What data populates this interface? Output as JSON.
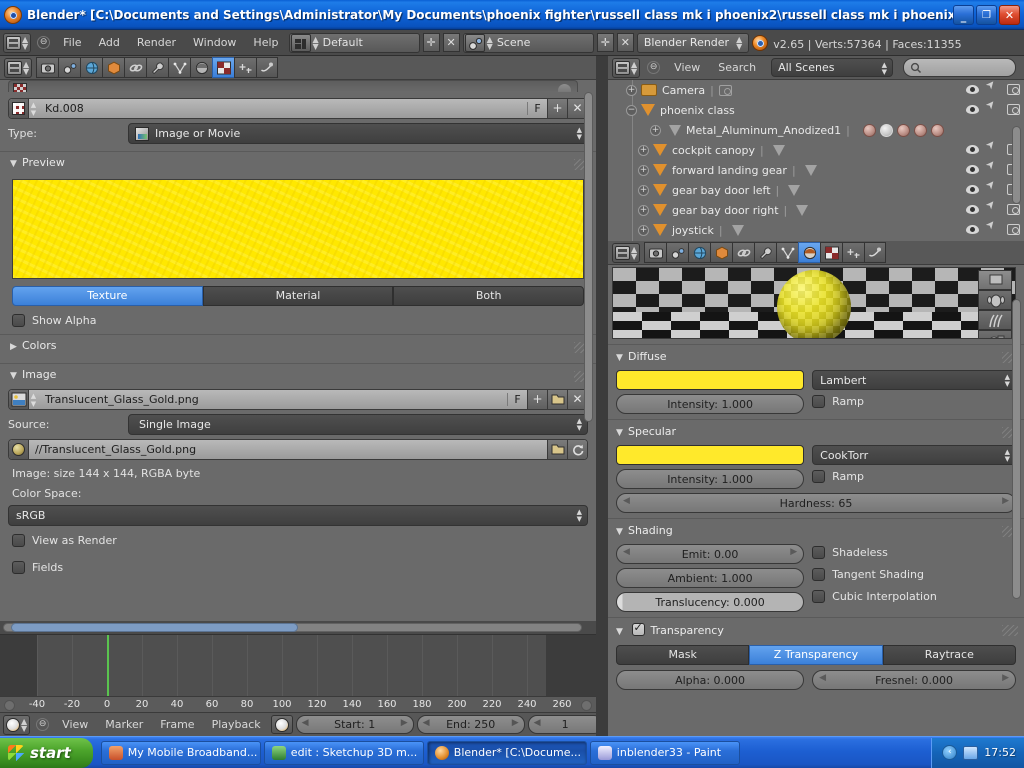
{
  "window": {
    "title": "Blender* [C:\\Documents and Settings\\Administrator\\My Documents\\phoenix fighter\\russell class mk i phoenix2\\russell class mk i phoenix.blend]",
    "minimize": "_",
    "maximize": "❐",
    "close": "✕"
  },
  "header": {
    "menus": [
      "File",
      "Add",
      "Render",
      "Window",
      "Help"
    ],
    "screen_layout": "Default",
    "scene": "Scene",
    "render_engine": "Blender Render",
    "stats": "v2.65 | Verts:57364 | Faces:11355"
  },
  "texture_panel": {
    "datablock_name": "Kd.008",
    "fake_user": "F",
    "add_label": "+",
    "unlink_label": "✕",
    "type_label": "Type:",
    "type_value": "Image or Movie",
    "preview_section": "Preview",
    "preview_color": "#ffe800",
    "preview_tabs": [
      "Texture",
      "Material",
      "Both"
    ],
    "preview_tab_active": 0,
    "show_alpha": "Show Alpha",
    "colors_section": "Colors",
    "image_section": "Image",
    "image_name": "Translucent_Glass_Gold.png",
    "source_label": "Source:",
    "source_value": "Single Image",
    "image_path": "//Translucent_Glass_Gold.png",
    "image_info": "Image: size 144 x 144, RGBA byte",
    "color_space_label": "Color Space:",
    "color_space_value": "sRGB",
    "view_as_render": "View as Render",
    "fields": "Fields"
  },
  "outliner": {
    "menus": [
      "View",
      "Search"
    ],
    "scene_filter": "All Scenes",
    "search_placeholder": "",
    "rows": [
      {
        "name": "Camera",
        "indent": 0,
        "icon": "camera-icon",
        "expand": "+",
        "has_data": true,
        "eye": true
      },
      {
        "name": "phoenix class",
        "indent": 0,
        "icon": "mesh-icon",
        "expand": "−",
        "has_data": false,
        "eye": true
      },
      {
        "name": "Metal_Aluminum_Anodized1",
        "indent": 1,
        "icon": "mesh-data-icon",
        "expand": "+",
        "materials": 5,
        "selected_material": 1,
        "eye": false
      },
      {
        "name": "cockpit canopy",
        "indent": 1,
        "icon": "mesh-icon",
        "expand": "+",
        "has_data": true,
        "eye": true
      },
      {
        "name": "forward landing gear",
        "indent": 1,
        "icon": "mesh-icon",
        "expand": "+",
        "has_data": true,
        "eye": true
      },
      {
        "name": "gear bay door left",
        "indent": 1,
        "icon": "mesh-icon",
        "expand": "+",
        "has_data": true,
        "eye": true
      },
      {
        "name": "gear bay door right",
        "indent": 1,
        "icon": "mesh-icon",
        "expand": "+",
        "has_data": true,
        "eye": true
      },
      {
        "name": "joystick",
        "indent": 1,
        "icon": "mesh-icon",
        "expand": "+",
        "has_data": true,
        "eye": true
      }
    ]
  },
  "material_panel": {
    "diffuse": {
      "title": "Diffuse",
      "color": "#ffe92b",
      "shader": "Lambert",
      "intensity": "Intensity: 1.000",
      "ramp": "Ramp"
    },
    "specular": {
      "title": "Specular",
      "color": "#ffe92b",
      "shader": "CookTorr",
      "intensity": "Intensity: 1.000",
      "ramp": "Ramp",
      "hardness": "Hardness: 65"
    },
    "shading": {
      "title": "Shading",
      "emit": "Emit: 0.00",
      "ambient": "Ambient: 1.000",
      "translucency": "Translucency: 0.000",
      "shadeless": "Shadeless",
      "tangent_shading": "Tangent Shading",
      "cubic_interpolation": "Cubic Interpolation"
    },
    "transparency": {
      "title": "Transparency",
      "enabled": true,
      "modes": [
        "Mask",
        "Z Transparency",
        "Raytrace"
      ],
      "active_mode": 1,
      "alpha": "Alpha: 0.000",
      "fresnel": "Fresnel: 0.000"
    }
  },
  "timeline": {
    "menus": [
      "View",
      "Marker",
      "Frame",
      "Playback"
    ],
    "start": "Start: 1",
    "end": "End: 250",
    "current_frame": "1",
    "ticks": [
      "-40",
      "-20",
      "0",
      "20",
      "40",
      "60",
      "80",
      "100",
      "120",
      "140",
      "160",
      "180",
      "200",
      "220",
      "240",
      "260"
    ],
    "playhead_frame": 0
  },
  "taskbar": {
    "start": "start",
    "tasks": [
      {
        "label": "My Mobile Broadband...",
        "active": false,
        "color": "#c8502a"
      },
      {
        "label": "edit : Sketchup 3D m...",
        "active": false,
        "color": "#3a8a3a"
      },
      {
        "label": "Blender* [C:\\Docume...",
        "active": true,
        "color": "#e08a28"
      },
      {
        "label": "inblender33 - Paint",
        "active": false,
        "color": "#d4d4f0"
      }
    ],
    "clock": "17:52"
  }
}
